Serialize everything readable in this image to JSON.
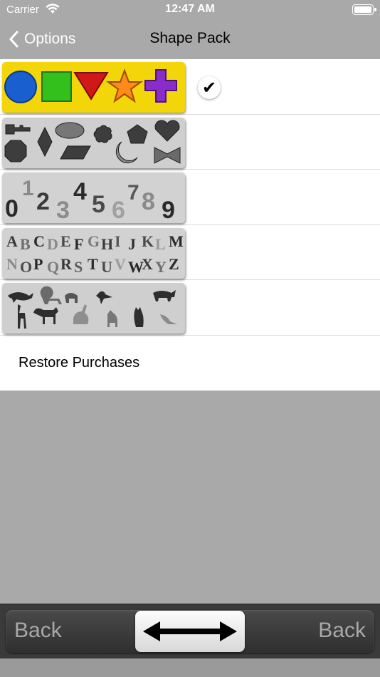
{
  "status": {
    "carrier": "Carrier",
    "time": "12:47 AM"
  },
  "nav": {
    "back_label": "Options",
    "title": "Shape Pack"
  },
  "packs": [
    {
      "name": "basic-shapes",
      "selected": true
    },
    {
      "name": "more-shapes",
      "selected": false
    },
    {
      "name": "numbers",
      "selected": false,
      "characters": [
        "0",
        "1",
        "2",
        "3",
        "4",
        "5",
        "6",
        "7",
        "8",
        "9"
      ]
    },
    {
      "name": "letters",
      "selected": false,
      "line1": [
        "A",
        "B",
        "C",
        "D",
        "E",
        "F",
        "G",
        "H",
        "I",
        "J",
        "K",
        "L",
        "M"
      ],
      "line2": [
        "N",
        "O",
        "P",
        "Q",
        "R",
        "S",
        "T",
        "U",
        "V",
        "W",
        "X",
        "Y",
        "Z"
      ]
    },
    {
      "name": "animals",
      "selected": false
    }
  ],
  "check_glyph": "✔",
  "restore_label": "Restore Purchases",
  "toolbar": {
    "back_left": "Back",
    "back_right": "Back"
  },
  "colors": {
    "background": "#a9a9a9",
    "toolbar": "#3a3a3a",
    "selected_pack": "#f0d400"
  }
}
